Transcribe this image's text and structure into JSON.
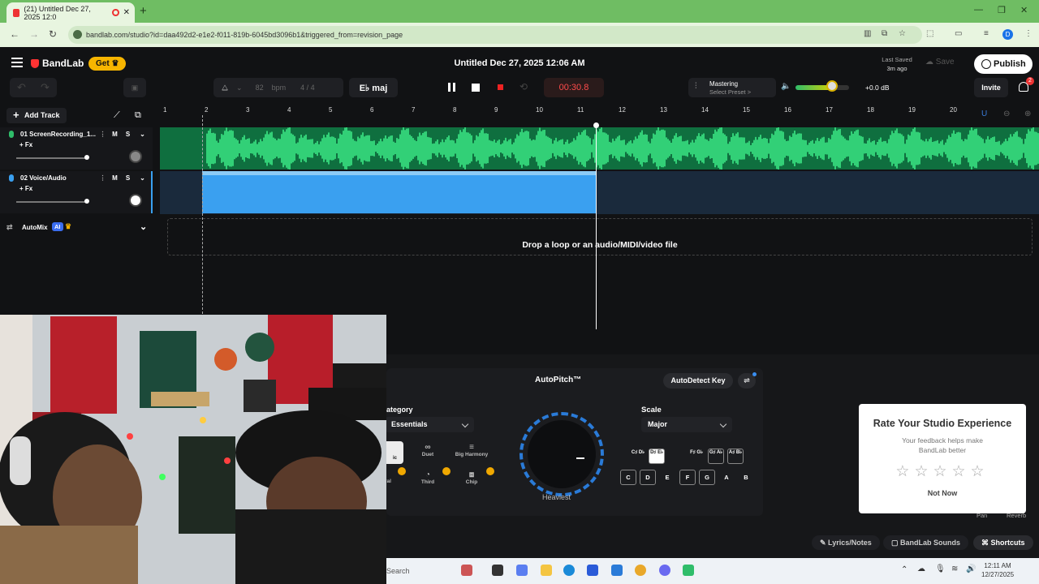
{
  "browser": {
    "tab_title": "(21) Untitled Dec 27, 2025 12:0",
    "url": "bandlab.com/studio?id=daa492d2-e1e2-f011-819b-6045bd3096b1&triggered_from=revision_page",
    "profile_initial": "D"
  },
  "header": {
    "logo": "BandLab",
    "get_label": "Get",
    "title": "Untitled Dec 27, 2025 12:06 AM",
    "last_saved_label": "Last Saved",
    "last_saved_value": "3m ago",
    "save_label": "Save",
    "publish_label": "Publish"
  },
  "transport": {
    "bpm_value": "82",
    "bpm_unit": "bpm",
    "time_sig": "4 / 4",
    "key": "E♭ maj",
    "time": "00:30.8",
    "mastering_label": "Mastering",
    "mastering_sub": "Select Preset >",
    "volume_db": "+0.0 dB",
    "volume_level": 0.65,
    "invite_label": "Invite",
    "notifications": "2"
  },
  "tracks_panel": {
    "add_track_label": "Add Track",
    "tracks": [
      {
        "name": "01  ScreenRecording_1...",
        "fx": "+ Fx",
        "color": "#2fbd6a",
        "m": "M",
        "s": "S"
      },
      {
        "name": "02  Voice/Audio",
        "fx": "+ Fx",
        "color": "#3aa0f0",
        "m": "M",
        "s": "S"
      }
    ],
    "automix_label": "AutoMix",
    "automix_badge": "AI"
  },
  "timeline": {
    "bars": [
      "1",
      "2",
      "3",
      "4",
      "5",
      "6",
      "7",
      "8",
      "9",
      "10",
      "11",
      "12",
      "13",
      "14",
      "15",
      "16",
      "17",
      "18",
      "19",
      "20"
    ],
    "drop_label": "Drop a loop or an audio/MIDI/video file"
  },
  "autopitch": {
    "title": "AutoPitch™",
    "autodetect_label": "AutoDetect Key",
    "category_label": "ategory",
    "category_value": "Essentials",
    "knob_label": "Heaviest",
    "scale_label": "Scale",
    "scale_value": "Major",
    "presets_row1": [
      "ic",
      "Duet",
      "Big Harmony"
    ],
    "presets_row2": [
      "ral",
      "Third",
      "Chip"
    ],
    "sharp_keys": [
      "C♯ D♭",
      "D♯ E♭",
      "F♯ G♭",
      "G♯ A♭",
      "A♯ B♭"
    ],
    "natural_keys": [
      "C",
      "D",
      "E",
      "F",
      "G",
      "A",
      "B"
    ]
  },
  "rate_dialog": {
    "title": "Rate Your Studio Experience",
    "subtitle": "Your feedback helps make BandLab better",
    "stars": "☆☆☆☆☆",
    "not_now": "Not Now"
  },
  "side_labels": {
    "pan": "Pan",
    "reverb": "Reverb"
  },
  "bottom_bar": {
    "lyrics": "Lyrics/Notes",
    "sounds": "BandLab Sounds",
    "shortcuts": "Shortcuts"
  },
  "taskbar": {
    "search": "Search",
    "time": "12:11 AM",
    "date": "12/27/2025"
  }
}
